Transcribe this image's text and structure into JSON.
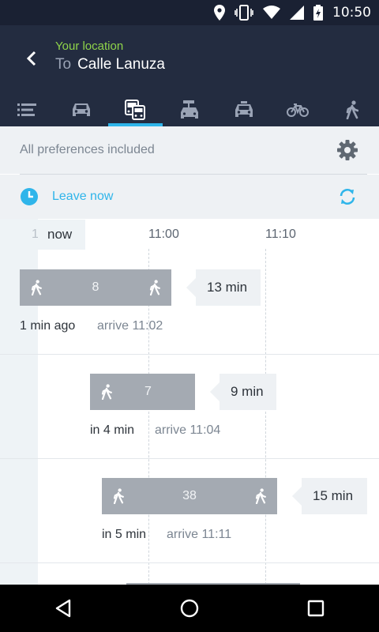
{
  "status_bar": {
    "time": "10:50",
    "icons": [
      "location-icon",
      "vibrate-icon",
      "wifi-icon",
      "signal-icon",
      "battery-charging-icon"
    ]
  },
  "header": {
    "from": "Your location",
    "to_prefix": "To",
    "to": "Calle Lanuza",
    "from_color": "#8fd44a",
    "accent": "#2fb5ea",
    "modes": [
      {
        "icon": "list-icon",
        "active": false
      },
      {
        "icon": "car-icon",
        "active": false
      },
      {
        "icon": "transit-icon",
        "active": true
      },
      {
        "icon": "car-sharing-icon",
        "active": false
      },
      {
        "icon": "taxi-icon",
        "active": false
      },
      {
        "icon": "bicycle-icon",
        "active": false
      },
      {
        "icon": "walk-icon",
        "active": false
      }
    ]
  },
  "preferences": {
    "label": "All preferences included"
  },
  "leave": {
    "label": "Leave now"
  },
  "timeline": {
    "now_label": "now",
    "now_gutter": "1",
    "ticks": [
      "11:00",
      "11:10"
    ],
    "routes": [
      {
        "line": "8",
        "duration": "13 min",
        "depart": "1 min ago",
        "arrive": "arrive 11:02"
      },
      {
        "line": "7",
        "duration": "9 min",
        "depart": "in 4 min",
        "arrive": "arrive 11:04"
      },
      {
        "line": "38",
        "duration": "15 min",
        "depart": "in 5 min",
        "arrive": "arrive 11:11"
      }
    ]
  }
}
